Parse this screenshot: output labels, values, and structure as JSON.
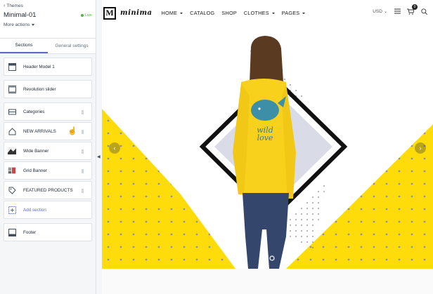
{
  "sidebar": {
    "back_label": "Themes",
    "theme_name": "Minimal-01",
    "status": "Live",
    "more_actions": "More actions",
    "tabs": [
      {
        "label": "Sections",
        "active": true
      },
      {
        "label": "General settings",
        "active": false
      }
    ],
    "sections": [
      {
        "label": "Header Model 1",
        "icon": "header-icon"
      },
      {
        "label": "Revolution slider",
        "icon": "slider-icon"
      },
      {
        "label": "Categories",
        "icon": "layout-icon"
      },
      {
        "label": "NEW ARRIVALS",
        "icon": "home-icon"
      },
      {
        "label": "Wide Banner",
        "icon": "image-thumbnail"
      },
      {
        "label": "Grid Banner",
        "icon": "image-thumbnail"
      },
      {
        "label": "FEATURED PRODUCTS",
        "icon": "tag-icon"
      }
    ],
    "add_section": "Add section",
    "footer": "Footer"
  },
  "preview": {
    "logo_letter": "M",
    "logo_text": "minima",
    "menu": [
      {
        "label": "HOME",
        "dropdown": true
      },
      {
        "label": "CATALOG",
        "dropdown": false
      },
      {
        "label": "SHOP",
        "dropdown": false
      },
      {
        "label": "CLOTHES",
        "dropdown": true
      },
      {
        "label": "PAGES",
        "dropdown": true
      }
    ],
    "currency": "USD",
    "cart_count": "0",
    "shirt_text_line1": "wild",
    "shirt_text_line2": "love"
  },
  "colors": {
    "accent": "#5c6ac4",
    "live": "#50b83c",
    "banner_yellow": "#fedc0a"
  }
}
